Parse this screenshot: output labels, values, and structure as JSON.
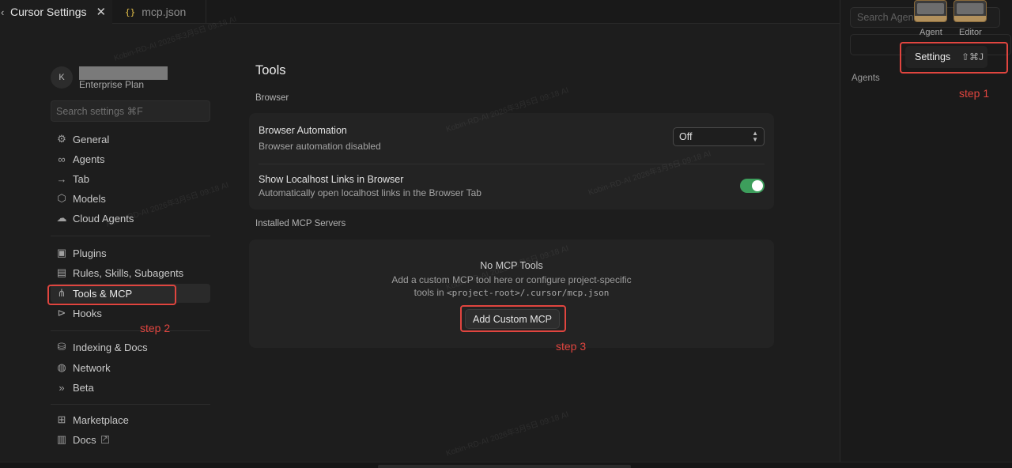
{
  "tabs": {
    "active_label": "Cursor Settings",
    "inactive_label": "mcp.json",
    "json_icon": "{}"
  },
  "sidebar": {
    "avatar_letter": "K",
    "plan": "Enterprise Plan",
    "search_placeholder": "Search settings ⌘F",
    "items": [
      {
        "label": "General",
        "icon": "gear-icon"
      },
      {
        "label": "Agents",
        "icon": "infinity-icon"
      },
      {
        "label": "Tab",
        "icon": "tab-arrow-icon"
      },
      {
        "label": "Models",
        "icon": "cube-icon"
      },
      {
        "label": "Cloud Agents",
        "icon": "cloud-icon"
      },
      {
        "label": "Plugins",
        "icon": "package-icon"
      },
      {
        "label": "Rules, Skills, Subagents",
        "icon": "document-icon"
      },
      {
        "label": "Tools & MCP",
        "icon": "share-nodes-icon",
        "selected": true
      },
      {
        "label": "Hooks",
        "icon": "hooks-icon"
      },
      {
        "label": "Indexing & Docs",
        "icon": "database-icon"
      },
      {
        "label": "Network",
        "icon": "globe-icon"
      },
      {
        "label": "Beta",
        "icon": "double-chevron-icon"
      },
      {
        "label": "Marketplace",
        "icon": "grid-plus-icon"
      },
      {
        "label": "Docs",
        "icon": "book-icon"
      }
    ]
  },
  "main": {
    "title": "Tools",
    "browser_section": "Browser",
    "browser_automation": {
      "title": "Browser Automation",
      "desc": "Browser automation disabled",
      "value": "Off"
    },
    "localhost_links": {
      "title": "Show Localhost Links in Browser",
      "desc": "Automatically open localhost links in the Browser Tab",
      "enabled": true
    },
    "mcp_section": "Installed MCP Servers",
    "mcp_empty": {
      "title": "No MCP Tools",
      "desc_line1": "Add a custom MCP tool here or configure project-specific",
      "desc_line2_prefix": "tools in ",
      "desc_line2_code": "<project-root>/.cursor/mcp.json",
      "button": "Add Custom MCP"
    }
  },
  "right_panel": {
    "search_placeholder": "Search Agents",
    "agents_label": "Agents",
    "layout_options": [
      "Agent",
      "Editor"
    ],
    "settings_menu": {
      "label": "Settings",
      "shortcut": "⇧⌘J"
    }
  },
  "annotations": {
    "step1": "step 1",
    "step2": "step 2",
    "step3": "step 3",
    "color": "#e0453f"
  },
  "watermark": "Kobin-RD-AI 2026年3月5日 09:18 AI"
}
